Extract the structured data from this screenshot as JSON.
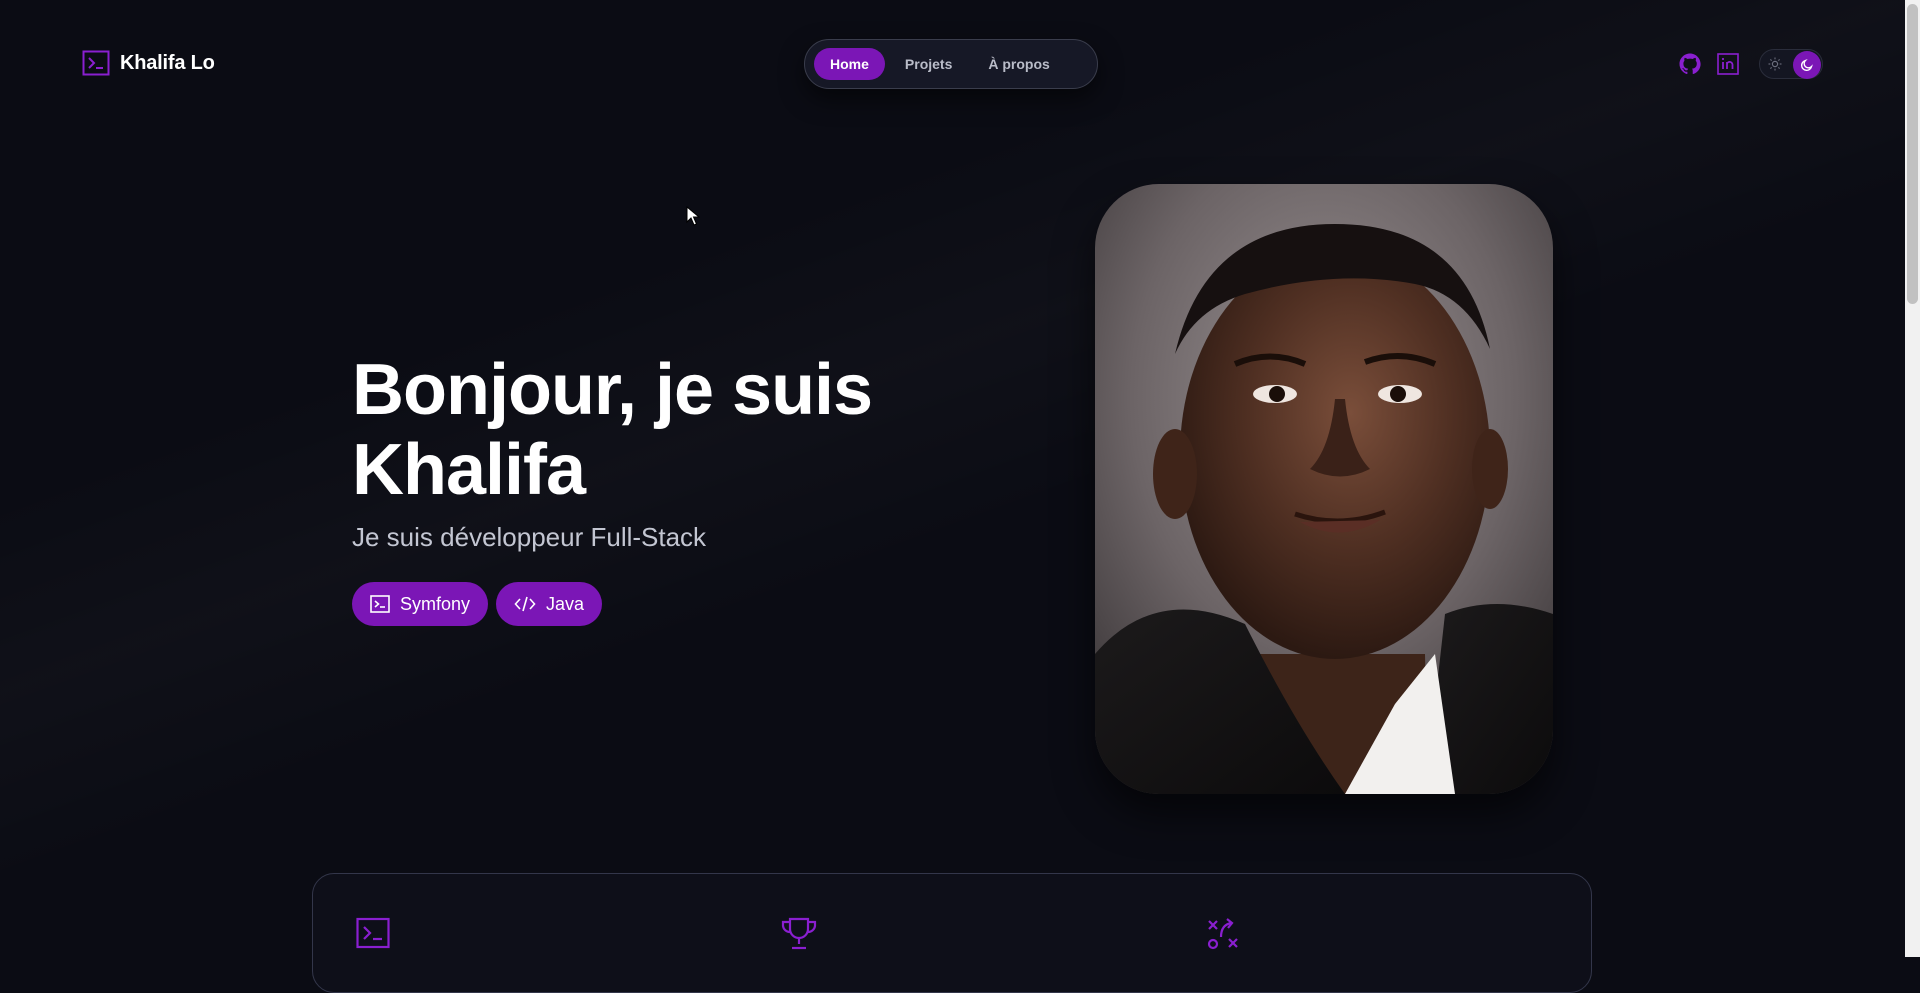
{
  "brand": {
    "name": "Khalifa Lo",
    "icon": "terminal-icon"
  },
  "nav": {
    "tabs": [
      {
        "label": "Home",
        "active": true
      },
      {
        "label": "Projets",
        "active": false
      },
      {
        "label": "À propos",
        "active": false
      }
    ]
  },
  "header_actions": {
    "github_icon": "github-icon",
    "linkedin_icon": "linkedin-icon",
    "theme_toggle": {
      "options": [
        "sun-icon",
        "moon-icon"
      ],
      "selected": "moon-icon"
    }
  },
  "hero": {
    "title_line1": "Bonjour, je suis",
    "title_line2": "Khalifa",
    "subtitle": "Je suis développeur Full-Stack",
    "tags": [
      {
        "label": "Symfony",
        "icon": "terminal-icon"
      },
      {
        "label": "Java",
        "icon": "code-icon"
      }
    ],
    "portrait_icon": "profile-photo"
  },
  "skills_card": {
    "icons": [
      "terminal-icon",
      "trophy-icon",
      "strategy-icon"
    ]
  },
  "colors": {
    "background": "#0b0c14",
    "accent": "#7b16b6",
    "text": "#ffffff",
    "muted_text": "#c3c6d2",
    "nav_background": "#161826"
  }
}
